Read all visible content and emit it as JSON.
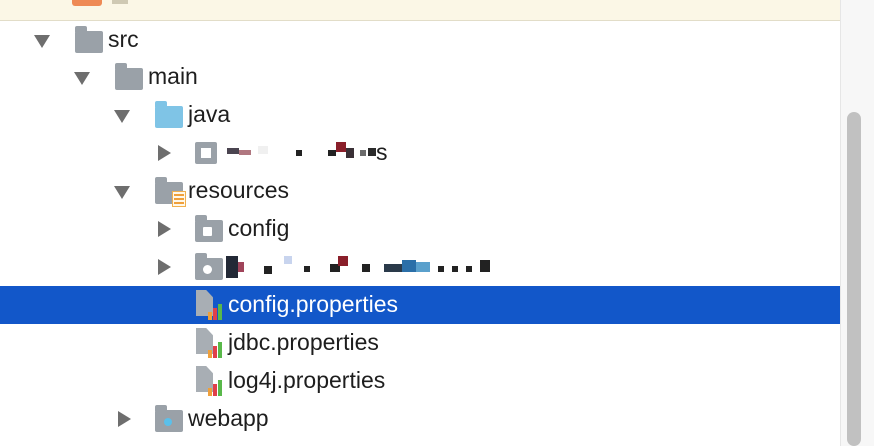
{
  "project_tree": {
    "items": [
      {
        "label": "src",
        "expanded": true,
        "icon": "folder-icon"
      },
      {
        "label": "main",
        "expanded": true,
        "icon": "folder-icon"
      },
      {
        "label": "java",
        "expanded": true,
        "icon": "source-folder-icon"
      },
      {
        "label": "s",
        "expanded": false,
        "icon": "package-icon",
        "redacted": true
      },
      {
        "label": "resources",
        "expanded": true,
        "icon": "resources-folder-icon"
      },
      {
        "label": "config",
        "expanded": false,
        "icon": "folder-icon"
      },
      {
        "label": "",
        "expanded": false,
        "icon": "folder-icon",
        "redacted": true
      },
      {
        "label": "config.properties",
        "selected": true,
        "icon": "properties-file-icon"
      },
      {
        "label": "jdbc.properties",
        "icon": "properties-file-icon"
      },
      {
        "label": "log4j.properties",
        "icon": "properties-file-icon"
      },
      {
        "label": "webapp",
        "expanded": false,
        "icon": "web-folder-icon"
      }
    ]
  },
  "colors": {
    "selection": "#1257c9",
    "folder": "#9aa1a8",
    "source_folder": "#7fc4e6",
    "scrollbar_thumb": "#c1c1c1"
  }
}
